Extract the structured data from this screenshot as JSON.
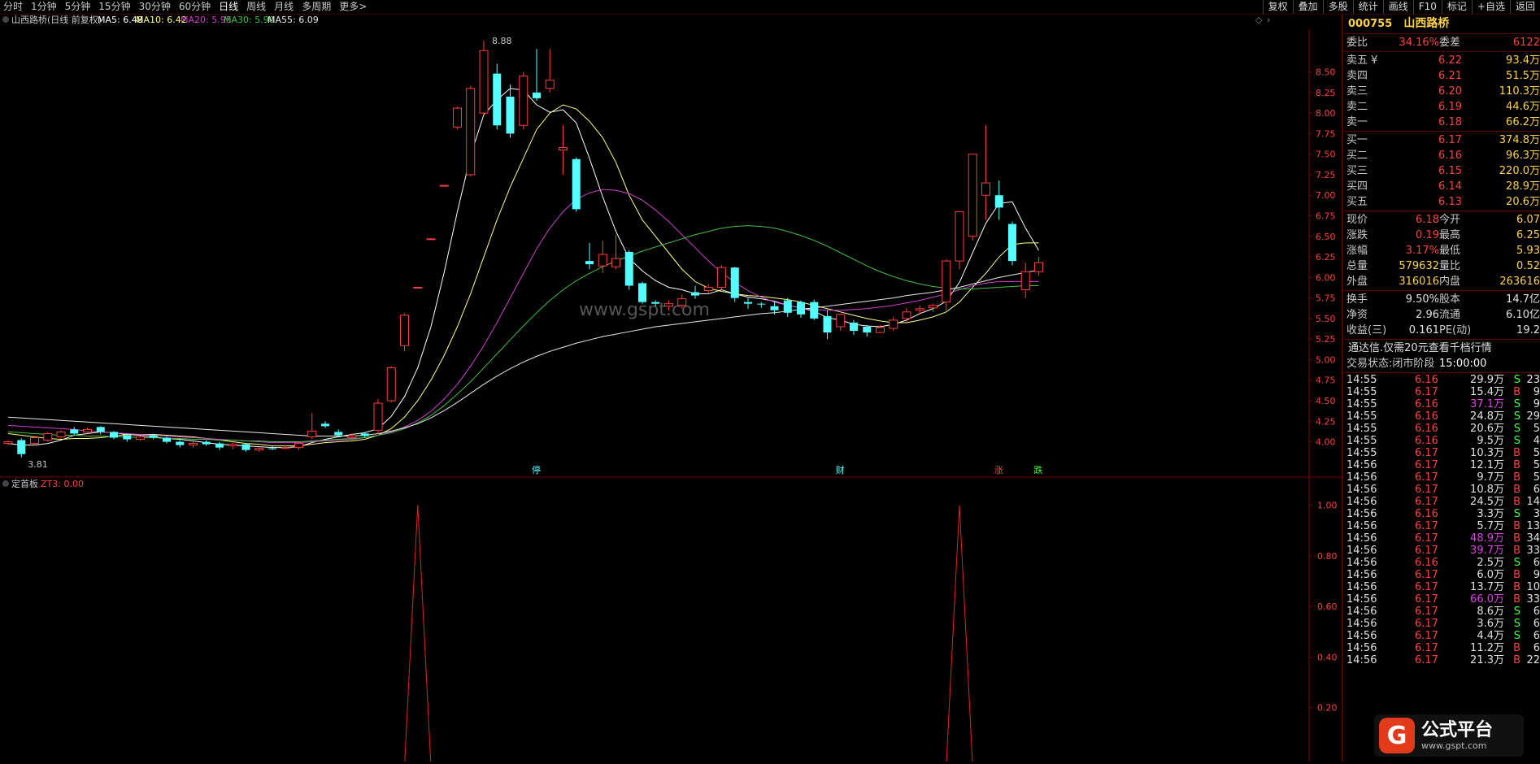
{
  "topbar": {
    "tabs": [
      "分时",
      "1分钟",
      "5分钟",
      "15分钟",
      "30分钟",
      "60分钟",
      "日线",
      "周线",
      "月线",
      "多周期",
      "更多>"
    ],
    "active_tab": "日线",
    "tools": [
      "复权",
      "叠加",
      "多股",
      "统计",
      "画线",
      "F10",
      "标记",
      "+自选",
      "返回"
    ]
  },
  "chart_header": {
    "name": "山西路桥(日线 前复权)",
    "ma5": "MA5: 6.48",
    "ma10": "MA10: 6.42",
    "ma20": "MA20: 5.95",
    "ma30": "MA30: 5.90",
    "ma55": "MA55: 6.09"
  },
  "indicator_header": {
    "name": "定首板",
    "zt": "ZT3: 0.00"
  },
  "watermark": "www.gspt.com",
  "chart_data": {
    "type": "candlestick",
    "price_ticks": [
      "8.50",
      "8.25",
      "8.00",
      "7.75",
      "7.50",
      "7.25",
      "7.00",
      "6.75",
      "6.50",
      "6.25",
      "6.00",
      "5.75",
      "5.50",
      "5.25",
      "5.00",
      "4.75",
      "4.50",
      "4.25",
      "4.00"
    ],
    "indicator_ticks": [
      "1.00",
      "0.80",
      "0.60",
      "0.40",
      "0.20"
    ],
    "high_label": "8.88",
    "low_label": "3.81",
    "markers": [
      {
        "text": "停",
        "i": 40
      },
      {
        "text": "财",
        "i": 63
      },
      {
        "text": "涨",
        "i": 75
      },
      {
        "text": "跌",
        "i": 78
      }
    ],
    "candles": [
      [
        3.98,
        4.0,
        3.96,
        4.02
      ],
      [
        4.02,
        3.85,
        3.81,
        4.04
      ],
      [
        3.98,
        4.05,
        3.96,
        4.07
      ],
      [
        4.02,
        4.1,
        4.0,
        4.12
      ],
      [
        4.06,
        4.12,
        4.04,
        4.14
      ],
      [
        4.15,
        4.1,
        4.08,
        4.18
      ],
      [
        4.12,
        4.15,
        4.1,
        4.17
      ],
      [
        4.18,
        4.12,
        4.09,
        4.19
      ],
      [
        4.12,
        4.05,
        4.03,
        4.13
      ],
      [
        4.08,
        4.03,
        4.0,
        4.1
      ],
      [
        4.03,
        4.06,
        4.01,
        4.08
      ],
      [
        4.08,
        4.05,
        4.03,
        4.1
      ],
      [
        4.05,
        4.0,
        3.98,
        4.06
      ],
      [
        4.0,
        3.96,
        3.93,
        4.02
      ],
      [
        3.96,
        3.98,
        3.93,
        4.03
      ],
      [
        4.0,
        3.97,
        3.95,
        4.02
      ],
      [
        3.98,
        3.93,
        3.9,
        4.0
      ],
      [
        3.95,
        3.97,
        3.91,
        3.99
      ],
      [
        3.97,
        3.9,
        3.88,
        3.98
      ],
      [
        3.9,
        3.92,
        3.88,
        3.93
      ],
      [
        3.92,
        3.91,
        3.9,
        3.95
      ],
      [
        3.92,
        3.93,
        3.91,
        3.96
      ],
      [
        3.93,
        3.98,
        3.9,
        4.0
      ],
      [
        4.06,
        4.13,
        4.03,
        4.35
      ],
      [
        4.22,
        4.19,
        4.17,
        4.25
      ],
      [
        4.12,
        4.08,
        4.06,
        4.15
      ],
      [
        4.05,
        4.07,
        4.03,
        4.1
      ],
      [
        4.1,
        4.07,
        4.05,
        4.12
      ],
      [
        4.14,
        4.47,
        4.1,
        4.52
      ],
      [
        4.5,
        4.9,
        4.48,
        4.92
      ],
      [
        5.17,
        5.54,
        5.1,
        5.56
      ],
      [
        5.88,
        5.88,
        5.88,
        5.88
      ],
      [
        6.47,
        6.47,
        6.47,
        6.47
      ],
      [
        7.12,
        7.12,
        7.12,
        7.12
      ],
      [
        7.83,
        8.06,
        7.8,
        8.08
      ],
      [
        7.25,
        8.3,
        7.23,
        8.33
      ],
      [
        8.0,
        8.76,
        7.98,
        8.88
      ],
      [
        8.48,
        7.85,
        7.8,
        8.6
      ],
      [
        8.2,
        7.75,
        7.7,
        8.35
      ],
      [
        7.85,
        8.45,
        7.8,
        8.5
      ],
      [
        8.25,
        8.18,
        8.15,
        8.78
      ],
      [
        8.3,
        8.4,
        8.25,
        8.78
      ],
      [
        7.55,
        7.58,
        7.25,
        7.85
      ],
      [
        7.44,
        6.83,
        6.8,
        7.46
      ],
      [
        6.2,
        6.16,
        6.1,
        6.42
      ],
      [
        6.14,
        6.28,
        6.05,
        6.45
      ],
      [
        6.13,
        6.23,
        6.1,
        6.52
      ],
      [
        6.31,
        5.9,
        5.85,
        6.33
      ],
      [
        5.93,
        5.7,
        5.68,
        5.95
      ],
      [
        5.7,
        5.68,
        5.65,
        5.72
      ],
      [
        5.65,
        5.68,
        5.6,
        5.72
      ],
      [
        5.66,
        5.74,
        5.62,
        5.79
      ],
      [
        5.82,
        5.78,
        5.74,
        5.9
      ],
      [
        5.84,
        5.88,
        5.8,
        5.92
      ],
      [
        5.88,
        6.12,
        5.85,
        6.15
      ],
      [
        6.12,
        5.75,
        5.7,
        6.13
      ],
      [
        5.7,
        5.68,
        5.62,
        5.75
      ],
      [
        5.68,
        5.67,
        5.63,
        5.7
      ],
      [
        5.65,
        5.6,
        5.55,
        5.7
      ],
      [
        5.72,
        5.57,
        5.52,
        5.75
      ],
      [
        5.7,
        5.55,
        5.51,
        5.72
      ],
      [
        5.7,
        5.5,
        5.48,
        5.73
      ],
      [
        5.53,
        5.33,
        5.25,
        5.6
      ],
      [
        5.4,
        5.55,
        5.35,
        5.56
      ],
      [
        5.45,
        5.35,
        5.3,
        5.48
      ],
      [
        5.4,
        5.33,
        5.28,
        5.42
      ],
      [
        5.33,
        5.39,
        5.32,
        5.42
      ],
      [
        5.38,
        5.48,
        5.35,
        5.52
      ],
      [
        5.5,
        5.58,
        5.45,
        5.63
      ],
      [
        5.6,
        5.62,
        5.55,
        5.66
      ],
      [
        5.63,
        5.66,
        5.58,
        5.68
      ],
      [
        5.7,
        6.2,
        5.6,
        6.22
      ],
      [
        6.2,
        6.8,
        6.1,
        6.8
      ],
      [
        6.5,
        7.5,
        6.45,
        7.5
      ],
      [
        7.0,
        7.15,
        6.7,
        7.85
      ],
      [
        7.0,
        6.85,
        6.7,
        7.18
      ],
      [
        6.65,
        6.2,
        6.15,
        6.68
      ],
      [
        5.85,
        6.07,
        5.75,
        6.18
      ],
      [
        6.07,
        6.18,
        6.02,
        6.25
      ]
    ],
    "ma_series": [
      {
        "color": "#ffffff",
        "values": [
          3.98,
          3.96,
          3.96,
          3.98,
          4.02,
          4.08,
          4.1,
          4.12,
          4.11,
          4.09,
          4.08,
          4.06,
          4.04,
          4.03,
          4.01,
          3.99,
          3.97,
          3.96,
          3.95,
          3.94,
          3.93,
          3.93,
          3.94,
          3.99,
          4.03,
          4.06,
          4.09,
          4.11,
          4.16,
          4.31,
          4.55,
          4.9,
          5.4,
          6.06,
          6.8,
          7.48,
          7.98,
          8.16,
          8.3,
          8.28,
          8.1,
          8.01,
          8.04,
          7.88,
          7.45,
          6.98,
          6.56,
          6.23,
          6.08,
          5.96,
          5.88,
          5.85,
          5.8,
          5.8,
          5.85,
          5.8,
          5.76,
          5.74,
          5.71,
          5.66,
          5.63,
          5.59,
          5.51,
          5.48,
          5.43,
          5.41,
          5.4,
          5.43,
          5.48,
          5.56,
          5.62,
          5.71,
          5.94,
          6.3,
          6.66,
          6.9,
          6.92,
          6.6,
          6.33
        ]
      },
      {
        "color": "#ffff80",
        "values": [
          4.1,
          4.08,
          4.06,
          4.04,
          4.03,
          4.04,
          4.04,
          4.05,
          4.07,
          4.09,
          4.09,
          4.09,
          4.08,
          4.07,
          4.06,
          4.04,
          4.02,
          4.0,
          3.98,
          3.97,
          3.95,
          3.95,
          3.95,
          3.97,
          3.99,
          4.0,
          4.01,
          4.03,
          4.08,
          4.16,
          4.3,
          4.5,
          4.75,
          5.05,
          5.4,
          5.8,
          6.25,
          6.7,
          7.1,
          7.45,
          7.8,
          8.0,
          8.1,
          8.05,
          7.9,
          7.7,
          7.4,
          7.0,
          6.7,
          6.5,
          6.3,
          6.1,
          5.95,
          5.87,
          5.83,
          5.8,
          5.78,
          5.77,
          5.75,
          5.73,
          5.7,
          5.66,
          5.62,
          5.58,
          5.54,
          5.5,
          5.47,
          5.45,
          5.45,
          5.48,
          5.52,
          5.58,
          5.7,
          5.88,
          6.05,
          6.25,
          6.4,
          6.42,
          6.42
        ]
      },
      {
        "color": "#d040d0",
        "values": [
          4.2,
          4.19,
          4.18,
          4.17,
          4.16,
          4.15,
          4.13,
          4.12,
          4.11,
          4.1,
          4.09,
          4.08,
          4.07,
          4.06,
          4.05,
          4.04,
          4.03,
          4.02,
          4.01,
          4.0,
          3.99,
          3.99,
          3.99,
          4.0,
          4.01,
          4.02,
          4.03,
          4.05,
          4.08,
          4.12,
          4.18,
          4.26,
          4.37,
          4.52,
          4.7,
          4.92,
          5.17,
          5.45,
          5.75,
          6.05,
          6.35,
          6.6,
          6.8,
          6.95,
          7.03,
          7.07,
          7.06,
          7.02,
          6.94,
          6.82,
          6.68,
          6.52,
          6.36,
          6.2,
          6.06,
          5.94,
          5.84,
          5.76,
          5.7,
          5.66,
          5.63,
          5.61,
          5.6,
          5.6,
          5.61,
          5.62,
          5.64,
          5.66,
          5.69,
          5.72,
          5.76,
          5.8,
          5.85,
          5.9,
          5.93,
          5.95,
          5.95,
          5.95,
          5.95
        ]
      },
      {
        "color": "#40c040",
        "values": [
          4.12,
          4.11,
          4.1,
          4.09,
          4.08,
          4.08,
          4.07,
          4.07,
          4.06,
          4.06,
          4.05,
          4.05,
          4.04,
          4.04,
          4.03,
          4.03,
          4.02,
          4.02,
          4.01,
          4.01,
          4.0,
          4.0,
          4.0,
          4.01,
          4.02,
          4.03,
          4.04,
          4.05,
          4.08,
          4.11,
          4.16,
          4.23,
          4.32,
          4.44,
          4.58,
          4.73,
          4.9,
          5.07,
          5.24,
          5.41,
          5.57,
          5.72,
          5.85,
          5.96,
          6.05,
          6.13,
          6.2,
          6.26,
          6.32,
          6.37,
          6.42,
          6.47,
          6.52,
          6.56,
          6.6,
          6.62,
          6.63,
          6.62,
          6.6,
          6.56,
          6.51,
          6.45,
          6.38,
          6.3,
          6.22,
          6.14,
          6.07,
          6.01,
          5.96,
          5.92,
          5.89,
          5.87,
          5.86,
          5.86,
          5.87,
          5.88,
          5.89,
          5.9,
          5.9
        ]
      },
      {
        "color": "#e8e8e8",
        "values": [
          4.3,
          4.29,
          4.28,
          4.27,
          4.26,
          4.25,
          4.24,
          4.23,
          4.22,
          4.21,
          4.2,
          4.19,
          4.18,
          4.17,
          4.16,
          4.15,
          4.14,
          4.13,
          4.12,
          4.11,
          4.1,
          4.09,
          4.08,
          4.07,
          4.07,
          4.07,
          4.07,
          4.08,
          4.1,
          4.13,
          4.17,
          4.22,
          4.29,
          4.38,
          4.48,
          4.59,
          4.7,
          4.8,
          4.89,
          4.97,
          5.04,
          5.1,
          5.15,
          5.2,
          5.24,
          5.28,
          5.31,
          5.34,
          5.37,
          5.4,
          5.42,
          5.44,
          5.46,
          5.48,
          5.5,
          5.52,
          5.54,
          5.56,
          5.57,
          5.59,
          5.61,
          5.63,
          5.65,
          5.67,
          5.69,
          5.71,
          5.73,
          5.75,
          5.78,
          5.8,
          5.82,
          5.85,
          5.88,
          5.92,
          5.96,
          6.0,
          6.03,
          6.06,
          6.09
        ]
      }
    ],
    "zt_spikes": [
      31,
      72
    ]
  },
  "quote": {
    "code": "000755",
    "name": "山西路桥",
    "weibi_label": "委比",
    "weibi": "34.16%",
    "weicha_label": "委差",
    "weicha": "6122",
    "asks": [
      {
        "label": "卖五 ¥",
        "price": "6.22",
        "vol": "93.4万"
      },
      {
        "label": "卖四",
        "price": "6.21",
        "vol": "51.5万"
      },
      {
        "label": "卖三",
        "price": "6.20",
        "vol": "110.3万"
      },
      {
        "label": "卖二",
        "price": "6.19",
        "vol": "44.6万"
      },
      {
        "label": "卖一",
        "price": "6.18",
        "vol": "66.2万"
      }
    ],
    "bids": [
      {
        "label": "买一",
        "price": "6.17",
        "vol": "374.8万"
      },
      {
        "label": "买二",
        "price": "6.16",
        "vol": "96.3万"
      },
      {
        "label": "买三",
        "price": "6.15",
        "vol": "220.0万"
      },
      {
        "label": "买四",
        "price": "6.14",
        "vol": "28.9万"
      },
      {
        "label": "买五",
        "price": "6.13",
        "vol": "20.6万"
      }
    ],
    "stats": [
      {
        "k1": "现价",
        "v1": "6.18",
        "k2": "今开",
        "v2": "6.07"
      },
      {
        "k1": "涨跌",
        "v1": "0.19",
        "k2": "最高",
        "v2": "6.25"
      },
      {
        "k1": "涨幅",
        "v1": "3.17%",
        "k2": "最低",
        "v2": "5.93"
      },
      {
        "k1": "总量",
        "v1": "579632",
        "k2": "量比",
        "v2": "0.52"
      },
      {
        "k1": "外盘",
        "v1": "316016",
        "k2": "内盘",
        "v2": "263616"
      }
    ],
    "stats2": [
      {
        "k1": "换手",
        "v1": "9.50%",
        "k2": "股本",
        "v2": "14.7亿"
      },
      {
        "k1": "净资",
        "v1": "2.96",
        "k2": "流通",
        "v2": "6.10亿"
      },
      {
        "k1": "收益(三)",
        "v1": "0.161",
        "k2": "PE(动)",
        "v2": "19.2"
      }
    ],
    "banner": "通达信.仅需20元查看千档行情",
    "status_label": "交易状态:闭市阶段",
    "status_time": "15:00:00",
    "ticks": [
      {
        "t": "14:55",
        "p": "6.16",
        "v": "29.9万",
        "bs": "S",
        "n": "23"
      },
      {
        "t": "14:55",
        "p": "6.17",
        "v": "15.4万",
        "bs": "B",
        "n": "9"
      },
      {
        "t": "14:55",
        "p": "6.16",
        "v": "37.1万",
        "bs": "S",
        "n": "9"
      },
      {
        "t": "14:55",
        "p": "6.16",
        "v": "24.8万",
        "bs": "S",
        "n": "29"
      },
      {
        "t": "14:55",
        "p": "6.16",
        "v": "20.6万",
        "bs": "S",
        "n": "5"
      },
      {
        "t": "14:55",
        "p": "6.16",
        "v": "9.5万",
        "bs": "S",
        "n": "4"
      },
      {
        "t": "14:55",
        "p": "6.17",
        "v": "10.3万",
        "bs": "B",
        "n": "5"
      },
      {
        "t": "14:56",
        "p": "6.17",
        "v": "12.1万",
        "bs": "B",
        "n": "5"
      },
      {
        "t": "14:56",
        "p": "6.17",
        "v": "9.7万",
        "bs": "B",
        "n": "5"
      },
      {
        "t": "14:56",
        "p": "6.17",
        "v": "10.8万",
        "bs": "B",
        "n": "6"
      },
      {
        "t": "14:56",
        "p": "6.17",
        "v": "24.5万",
        "bs": "B",
        "n": "14"
      },
      {
        "t": "14:56",
        "p": "6.16",
        "v": "3.3万",
        "bs": "S",
        "n": "3"
      },
      {
        "t": "14:56",
        "p": "6.17",
        "v": "5.7万",
        "bs": "B",
        "n": "13"
      },
      {
        "t": "14:56",
        "p": "6.17",
        "v": "48.9万",
        "bs": "B",
        "n": "34"
      },
      {
        "t": "14:56",
        "p": "6.17",
        "v": "39.7万",
        "bs": "B",
        "n": "33"
      },
      {
        "t": "14:56",
        "p": "6.16",
        "v": "2.5万",
        "bs": "S",
        "n": "6"
      },
      {
        "t": "14:56",
        "p": "6.17",
        "v": "6.0万",
        "bs": "B",
        "n": "9"
      },
      {
        "t": "14:56",
        "p": "6.17",
        "v": "13.7万",
        "bs": "B",
        "n": "10"
      },
      {
        "t": "14:56",
        "p": "6.17",
        "v": "66.0万",
        "bs": "B",
        "n": "33"
      },
      {
        "t": "14:56",
        "p": "6.17",
        "v": "8.6万",
        "bs": "S",
        "n": "6"
      },
      {
        "t": "14:56",
        "p": "6.17",
        "v": "3.6万",
        "bs": "S",
        "n": "6"
      },
      {
        "t": "14:56",
        "p": "6.17",
        "v": "4.4万",
        "bs": "S",
        "n": "6"
      },
      {
        "t": "14:56",
        "p": "6.17",
        "v": "11.2万",
        "bs": "B",
        "n": "6"
      },
      {
        "t": "14:56",
        "p": "6.17",
        "v": "21.3万",
        "bs": "B",
        "n": "22"
      }
    ]
  },
  "logo": {
    "mark": "G",
    "title": "公式平台",
    "url": "www.gspt.com"
  }
}
